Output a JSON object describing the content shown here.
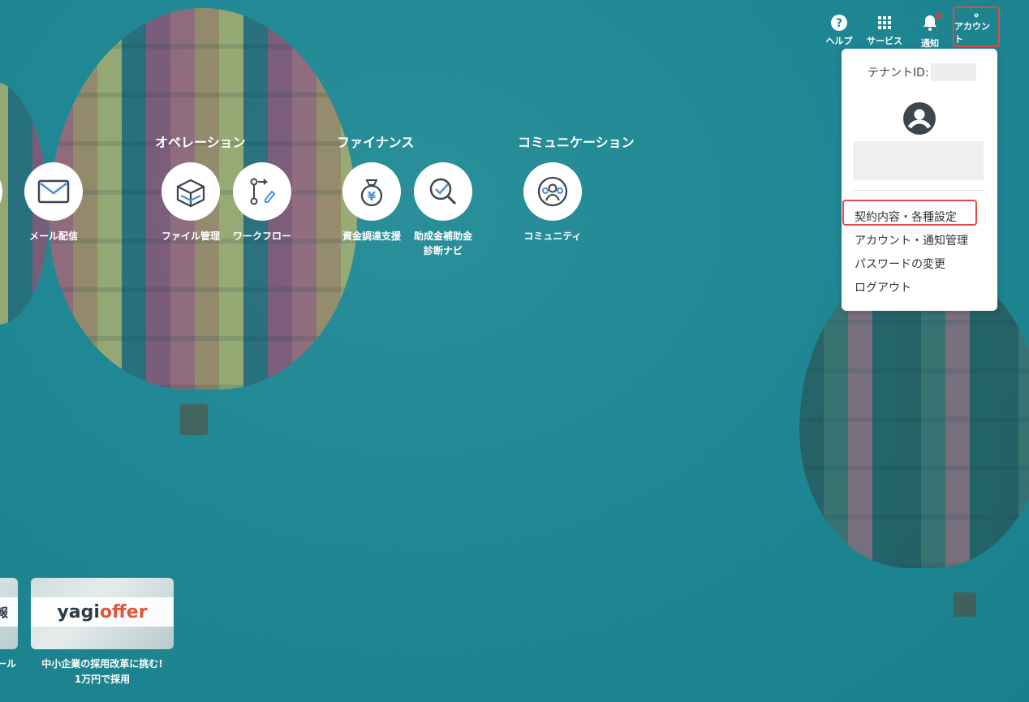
{
  "topbar": {
    "help_label": "ヘルプ",
    "services_label": "サービス",
    "notifications_label": "通知",
    "account_label": "アカウント"
  },
  "dropdown": {
    "tenant_label": "テナントID:",
    "items": [
      {
        "label": "契約内容・各種設定"
      },
      {
        "label": "アカウント・通知管理"
      },
      {
        "label": "パスワードの変更"
      },
      {
        "label": "ログアウト"
      }
    ]
  },
  "categories": {
    "operation": "オペレーション",
    "finance": "ファイナンス",
    "communication": "コミュニケーション"
  },
  "apps": {
    "mail": "メール配信",
    "file": "ファイル管理",
    "workflow": "ワークフロー",
    "funding": "資金調達支援",
    "subsidy": "助成金補助金\n診断ナビ",
    "community": "コミュニティ"
  },
  "banners": {
    "left_strip_text": "報",
    "left_caption": "ール",
    "yagi_part1": "yagi",
    "yagi_part2": "offer",
    "yagi_caption": "中小企業の採用改革に挑む!\n1万円で採用"
  },
  "colors": {
    "background": "#1f8894",
    "highlight": "#e24b42",
    "icon_dark": "#3d4650",
    "icon_accent": "#4a90d9"
  }
}
